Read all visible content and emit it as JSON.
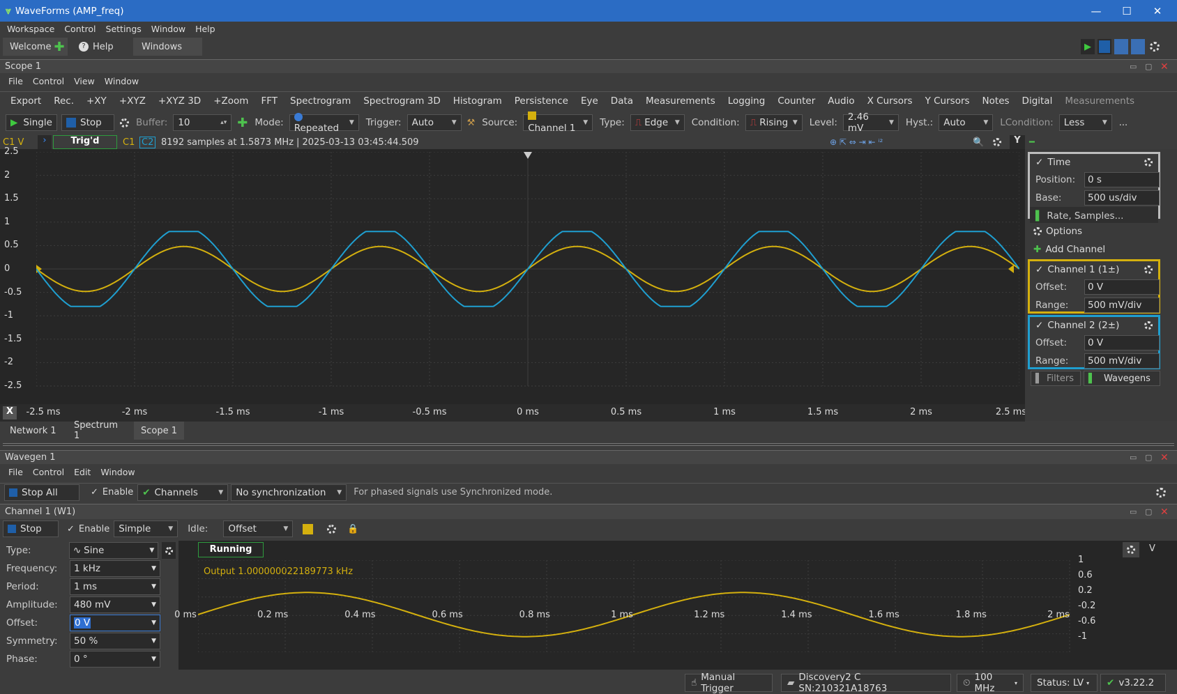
{
  "window": {
    "title": "WaveForms (AMP_freq)",
    "minimize": "—",
    "maximize": "☐",
    "close": "✕"
  },
  "app_menu": [
    "Workspace",
    "Control",
    "Settings",
    "Window",
    "Help"
  ],
  "main_tabs": {
    "welcome": "Welcome",
    "help": "Help",
    "windows": "Windows"
  },
  "scope": {
    "title": "Scope 1",
    "menu": [
      "File",
      "Control",
      "View",
      "Window"
    ],
    "toolbar": [
      "Export",
      "Rec.",
      "+XY",
      "+XYZ",
      "+XYZ 3D",
      "+Zoom",
      "FFT",
      "Spectrogram",
      "Spectrogram 3D",
      "Histogram",
      "Persistence",
      "Eye",
      "Data",
      "Measurements",
      "Logging",
      "Counter",
      "Audio",
      "X Cursors",
      "Y Cursors",
      "Notes",
      "Digital",
      "Measurements"
    ],
    "trigger_bar": {
      "single": "Single",
      "stop": "Stop",
      "buffer_label": "Buffer:",
      "buffer": "10",
      "mode_label": "Mode:",
      "mode": "Repeated",
      "trigger_label": "Trigger:",
      "trigger": "Auto",
      "source_label": "Source:",
      "source": "Channel 1",
      "type_label": "Type:",
      "type": "Edge",
      "condition_label": "Condition:",
      "condition": "Rising",
      "level_label": "Level:",
      "level": "2.46 mV",
      "hyst_label": "Hyst.:",
      "hyst": "Auto",
      "lcond_label": "LCondition:",
      "lcond": "Less",
      "more": "..."
    },
    "status_line": {
      "unit": "C1 V",
      "state": "Trig'd",
      "c1": "C1",
      "c2": "C2",
      "info": "8192 samples at 1.5873 MHz",
      "time": "| 2025-03-13 03:45:44.509",
      "y_btn": "Y",
      "x_btn": "X"
    },
    "y_ticks": [
      "2.5",
      "2",
      "1.5",
      "1",
      "0.5",
      "0",
      "-0.5",
      "-1",
      "-1.5",
      "-2",
      "-2.5"
    ],
    "x_ticks": [
      "-2.5 ms",
      "-2 ms",
      "-1.5 ms",
      "-1 ms",
      "-0.5 ms",
      "0 ms",
      "0.5 ms",
      "1 ms",
      "1.5 ms",
      "2 ms",
      "2.5 ms"
    ],
    "bottom_tabs": [
      "Network 1",
      "Spectrum 1",
      "Scope 1"
    ],
    "side": {
      "time": "Time",
      "position_label": "Position:",
      "position": "0 s",
      "base_label": "Base:",
      "base": "500 us/div",
      "rate": "Rate, Samples...",
      "options": "Options",
      "add_channel": "Add Channel",
      "ch1": "Channel 1 (1±)",
      "ch1_offset": "0 V",
      "ch1_range": "500 mV/div",
      "ch2": "Channel 2 (2±)",
      "ch2_offset": "0 V",
      "ch2_range": "500 mV/div",
      "offset_label": "Offset:",
      "range_label": "Range:",
      "filters": "Filters",
      "wavegens": "Wavegens"
    },
    "colors": {
      "ch1": "#d4b00e",
      "ch2": "#1f9fd0"
    }
  },
  "wavegen": {
    "title": "Wavegen 1",
    "menu": [
      "File",
      "Control",
      "Edit",
      "Window"
    ],
    "stop_all": "Stop All",
    "enable": "Enable",
    "channels": "Channels",
    "sync": "No synchronization",
    "hint": "For phased signals use Synchronized mode.",
    "channel_title": "Channel 1 (W1)",
    "stop": "Stop",
    "mode": "Simple",
    "idle_label": "Idle:",
    "idle": "Offset",
    "fields": [
      {
        "label": "Type:",
        "value": "Sine"
      },
      {
        "label": "Frequency:",
        "value": "1 kHz"
      },
      {
        "label": "Period:",
        "value": "1 ms"
      },
      {
        "label": "Amplitude:",
        "value": "480 mV"
      },
      {
        "label": "Offset:",
        "value": "0 V"
      },
      {
        "label": "Symmetry:",
        "value": "50 %"
      },
      {
        "label": "Phase:",
        "value": "0 °"
      }
    ],
    "running": "Running",
    "output": "Output 1.000000022189773 kHz",
    "unit": "V",
    "y_ticks": [
      "1",
      "0.6",
      "0.2",
      "-0.2",
      "-0.6",
      "-1"
    ],
    "x_ticks": [
      "0 ms",
      "0.2 ms",
      "0.4 ms",
      "0.6 ms",
      "0.8 ms",
      "1 ms",
      "1.2 ms",
      "1.4 ms",
      "1.6 ms",
      "1.8 ms",
      "2 ms"
    ]
  },
  "statusbar": {
    "manual": "Manual Trigger",
    "device": "Discovery2 C SN:210321A18763",
    "clock": "100 MHz",
    "status": "Status: LV",
    "version": "v3.22.2"
  },
  "chart_data": [
    {
      "type": "line",
      "x_range": [
        -2.5,
        2.5
      ],
      "y_range": [
        -2.5,
        2.5
      ],
      "xlabel": "",
      "ylabel": "C1 V",
      "series": [
        {
          "name": "C1",
          "frequency_khz": 1,
          "amplitude_v": 0.48
        },
        {
          "name": "C2",
          "frequency_khz": 1,
          "amplitude_v": 0.8,
          "clipped": true
        }
      ]
    },
    {
      "type": "line",
      "x_range": [
        0,
        2
      ],
      "y_range": [
        -1,
        1
      ],
      "ylabel": "V",
      "series": [
        {
          "name": "Output",
          "frequency_khz": 1,
          "amplitude_v": 0.48
        }
      ]
    }
  ]
}
